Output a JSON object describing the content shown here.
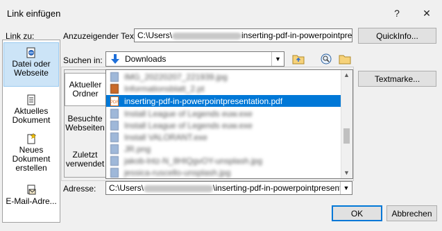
{
  "dialog": {
    "title": "Link einfügen",
    "help_label": "?",
    "close_label": "✕"
  },
  "link_to": {
    "label": "Link zu:",
    "items": [
      {
        "label": "Datei oder Webseite",
        "selected": true,
        "icon": "web-page-icon"
      },
      {
        "label": "Aktuelles Dokument",
        "selected": false,
        "icon": "document-icon"
      },
      {
        "label": "Neues Dokument erstellen",
        "selected": false,
        "icon": "new-document-icon"
      },
      {
        "label": "E-Mail-Adre...",
        "selected": false,
        "icon": "email-icon"
      }
    ]
  },
  "display_text": {
    "label": "Anzuzeigender Text:",
    "value_prefix": "C:\\Users\\",
    "value_suffix": "inserting-pdf-in-powerpointpres"
  },
  "quickinfo_button": "QuickInfo...",
  "search_in": {
    "label": "Suchen in:",
    "value": "Downloads"
  },
  "places": [
    {
      "label": "Aktueller Ordner",
      "selected": true
    },
    {
      "label": "Besuchte Webseiten",
      "selected": false
    },
    {
      "label": "Zuletzt verwendet",
      "selected": false
    }
  ],
  "files": [
    {
      "name": "IMG_20220207_221939.jpg",
      "blurred": true,
      "selected": false
    },
    {
      "name": "Informationsblatt_2.pt",
      "blurred": true,
      "selected": false
    },
    {
      "name": "inserting-pdf-in-powerpointpresentation.pdf",
      "blurred": false,
      "selected": true
    },
    {
      "name": "Install League of Legends euw.exe",
      "blurred": true,
      "selected": false
    },
    {
      "name": "Install League of Legends euw.exe",
      "blurred": true,
      "selected": false
    },
    {
      "name": "Install VALORANT.exe",
      "blurred": true,
      "selected": false
    },
    {
      "name": "JR.png",
      "blurred": true,
      "selected": false
    },
    {
      "name": "jakob-lntz-N_8HIQgvOY-unsplash.jpg",
      "blurred": true,
      "selected": false
    },
    {
      "name": "jessica-ruscello-unsplash.jpg",
      "blurred": true,
      "selected": false
    }
  ],
  "bookmark_button": "Textmarke...",
  "address": {
    "label": "Adresse:",
    "value_prefix": "C:\\Users\\",
    "value_suffix": "\\inserting-pdf-in-powerpointpresentat"
  },
  "ok_button": "OK",
  "cancel_button": "Abbrechen",
  "colors": {
    "selection": "#0078d7",
    "sidebar_selected": "#cce4f7",
    "dialog_bg": "#f0f0f0"
  }
}
